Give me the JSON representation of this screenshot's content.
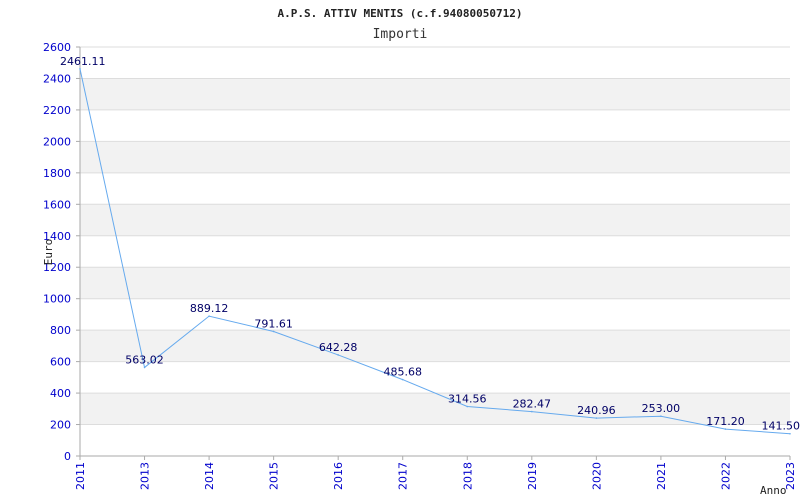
{
  "chart_data": {
    "type": "line",
    "title": "A.P.S. ATTIV  MENTIS (c.f.94080050712)",
    "subtitle": "Importi",
    "xlabel": "Anno",
    "ylabel": "Euro",
    "categories": [
      "2011",
      "2013",
      "2014",
      "2015",
      "2016",
      "2017",
      "2018",
      "2019",
      "2020",
      "2021",
      "2022",
      "2023"
    ],
    "series": [
      {
        "values": [
          2461.11,
          563.02,
          889.12,
          791.61,
          642.28,
          485.68,
          314.56,
          282.47,
          240.96,
          253.0,
          171.2,
          141.5
        ],
        "labels": [
          "2461.11",
          "563.02",
          "889.12",
          "791.61",
          "642.28",
          "485.68",
          "314.56",
          "282.47",
          "240.96",
          "253.00",
          "171.20",
          "141.50"
        ]
      }
    ],
    "ylim": [
      0,
      2600
    ],
    "yticks": [
      0,
      200,
      400,
      600,
      800,
      1000,
      1200,
      1400,
      1600,
      1800,
      2000,
      2200,
      2400,
      2600
    ],
    "grid": true,
    "colors": {
      "line": "#66aaee",
      "band": "#f2f2f2",
      "grid": "#dddddd",
      "axis": "#aaaaaa",
      "tick_text": "#0000cc",
      "data_label": "#000066"
    }
  }
}
